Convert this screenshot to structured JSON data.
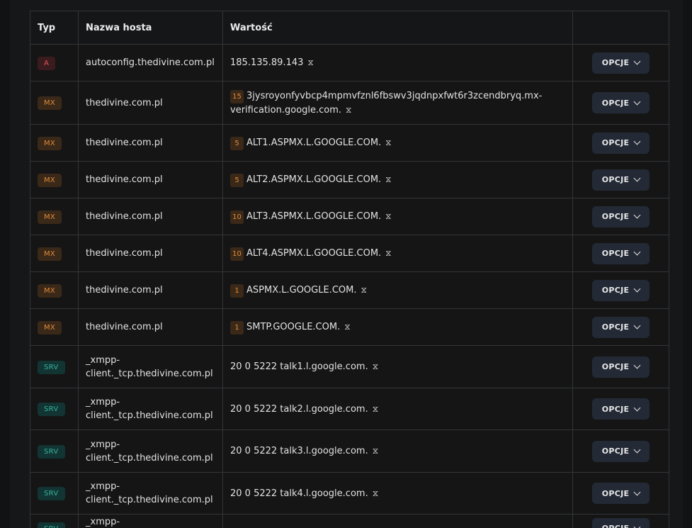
{
  "table": {
    "headers": {
      "type": "Typ",
      "host": "Nazwa hosta",
      "value": "Wartość",
      "actions": ""
    },
    "options_label": "OPCJE",
    "ttl_icon": "hourglass-icon",
    "rows": [
      {
        "type": "A",
        "host": "autoconfig.thedivine.com.pl",
        "priority": "",
        "value": "185.135.89.143"
      },
      {
        "type": "MX",
        "host": "thedivine.com.pl",
        "priority": "15",
        "value": "3jysroyonfyvbcp4mpmvfznl6fbswv3jqdnpxfwt6r3zcendbryq.mx-verification.google.com."
      },
      {
        "type": "MX",
        "host": "thedivine.com.pl",
        "priority": "5",
        "value": "ALT1.ASPMX.L.GOOGLE.COM."
      },
      {
        "type": "MX",
        "host": "thedivine.com.pl",
        "priority": "5",
        "value": "ALT2.ASPMX.L.GOOGLE.COM."
      },
      {
        "type": "MX",
        "host": "thedivine.com.pl",
        "priority": "10",
        "value": "ALT3.ASPMX.L.GOOGLE.COM."
      },
      {
        "type": "MX",
        "host": "thedivine.com.pl",
        "priority": "10",
        "value": "ALT4.ASPMX.L.GOOGLE.COM."
      },
      {
        "type": "MX",
        "host": "thedivine.com.pl",
        "priority": "1",
        "value": "ASPMX.L.GOOGLE.COM."
      },
      {
        "type": "MX",
        "host": "thedivine.com.pl",
        "priority": "1",
        "value": "SMTP.GOOGLE.COM."
      },
      {
        "type": "SRV",
        "host": "_xmpp-client._tcp.thedivine.com.pl",
        "priority": "",
        "value": "20 0 5222 talk1.l.google.com."
      },
      {
        "type": "SRV",
        "host": "_xmpp-client._tcp.thedivine.com.pl",
        "priority": "",
        "value": "20 0 5222 talk2.l.google.com."
      },
      {
        "type": "SRV",
        "host": "_xmpp-client._tcp.thedivine.com.pl",
        "priority": "",
        "value": "20 0 5222 talk3.l.google.com."
      },
      {
        "type": "SRV",
        "host": "_xmpp-client._tcp.thedivine.com.pl",
        "priority": "",
        "value": "20 0 5222 talk4.l.google.com."
      },
      {
        "type": "SRV",
        "host": "_xmpp-client._tcp.thedivine.com.pl",
        "priority": "",
        "value": ""
      }
    ]
  }
}
